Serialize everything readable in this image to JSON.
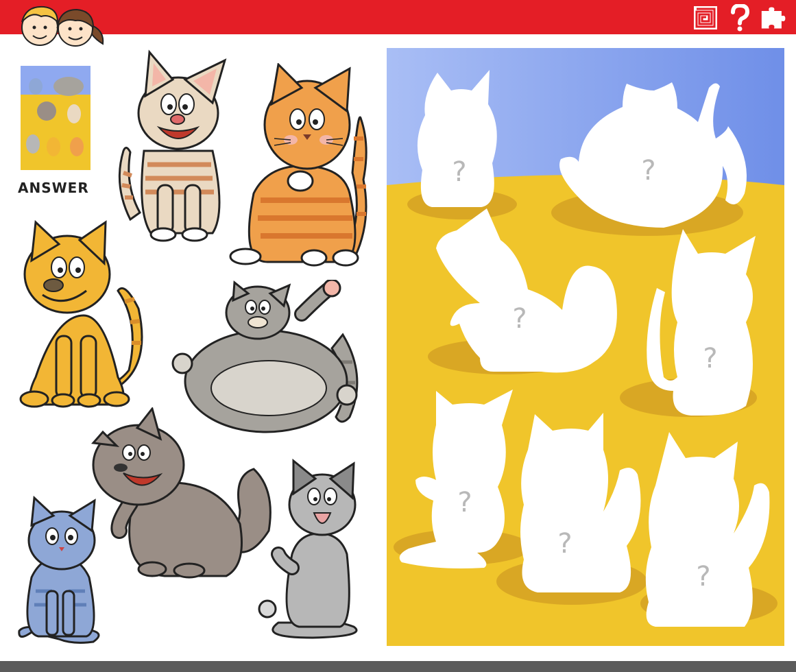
{
  "header": {
    "icons": [
      "spiral-maze-icon",
      "question-mark-icon",
      "puzzle-piece-icon"
    ],
    "bar_color": "#e41e26"
  },
  "answer": {
    "label": "ANSWER"
  },
  "cats": [
    {
      "name": "cream-striped-cat",
      "colors": [
        "#ead9c2",
        "#d28a5a"
      ]
    },
    {
      "name": "orange-striped-cat",
      "colors": [
        "#f0a04b",
        "#d9772e"
      ]
    },
    {
      "name": "yellow-cat",
      "colors": [
        "#f2b635",
        "#d98e2a"
      ]
    },
    {
      "name": "fat-gray-cat",
      "colors": [
        "#a6a39d",
        "#d8d4cc"
      ]
    },
    {
      "name": "fluffy-brown-cat",
      "colors": [
        "#9a8e86",
        "#c7bfb8"
      ]
    },
    {
      "name": "blue-kitten",
      "colors": [
        "#8ea7d6",
        "#5f7fb8"
      ]
    },
    {
      "name": "gray-kitten",
      "colors": [
        "#b7b7b7",
        "#8a8a8a"
      ]
    }
  ],
  "shadow_panel": {
    "sky_color": "#8fa9f0",
    "ground_color": "#f0c52b",
    "silhouette_color": "#ffffff",
    "mark_symbol": "?"
  }
}
